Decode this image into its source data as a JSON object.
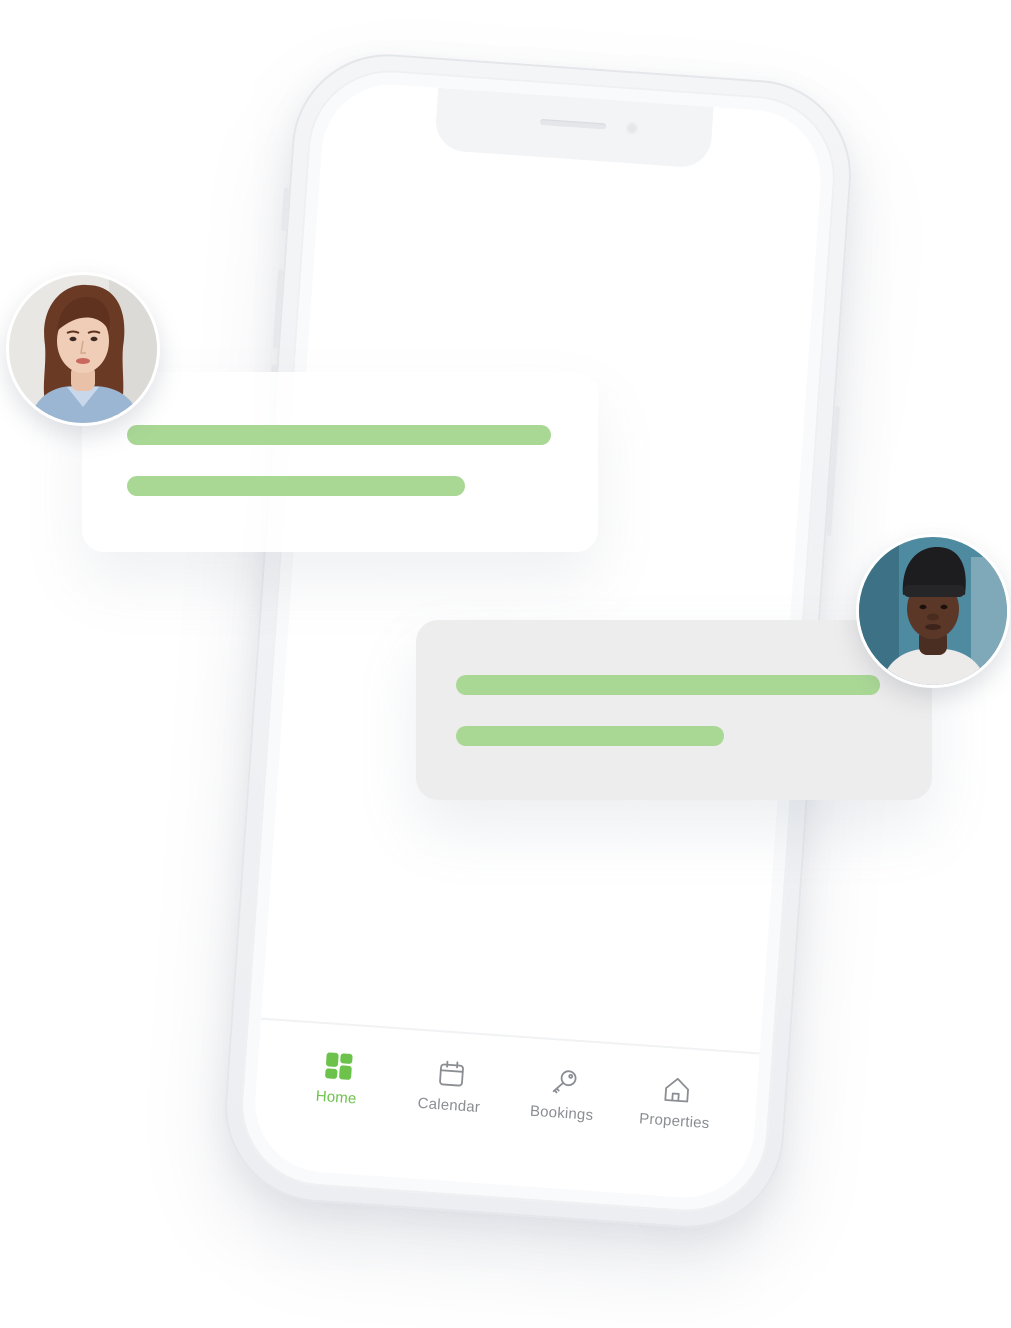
{
  "colors": {
    "accent": "#6cc24a",
    "inactive_tab": "#8a8d92",
    "message_line": "#a9d895",
    "card_light": "#ffffff",
    "card_grey": "#edecec"
  },
  "tab_bar": {
    "tabs": [
      {
        "label": "Home",
        "icon": "grid-icon",
        "active": true
      },
      {
        "label": "Calendar",
        "icon": "calendar-icon",
        "active": false
      },
      {
        "label": "Bookings",
        "icon": "key-icon",
        "active": false
      },
      {
        "label": "Properties",
        "icon": "house-icon",
        "active": false
      }
    ]
  },
  "messages": [
    {
      "avatar": "woman-avatar",
      "lines": 2
    },
    {
      "avatar": "man-avatar",
      "lines": 2
    }
  ]
}
